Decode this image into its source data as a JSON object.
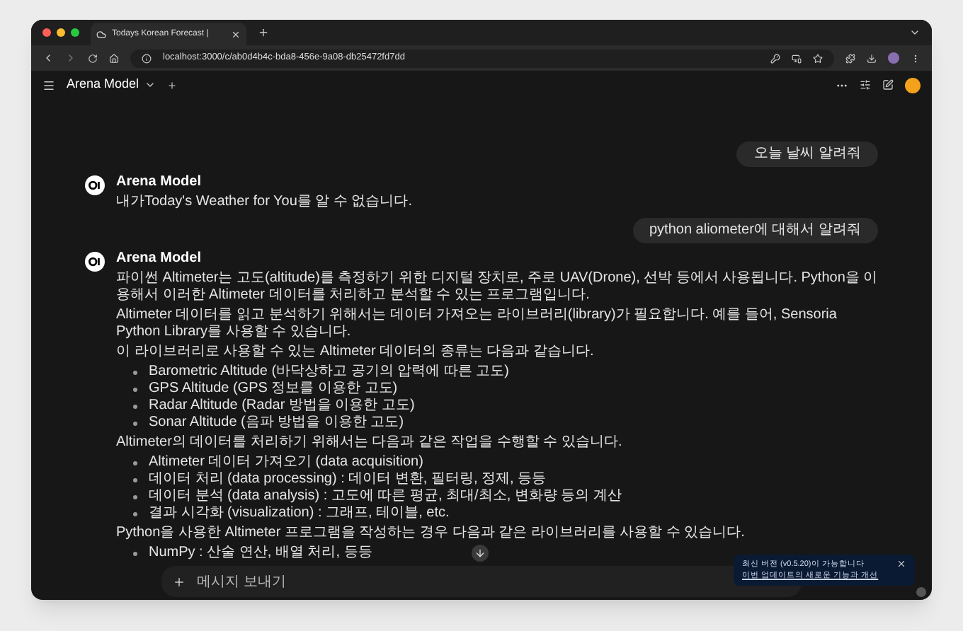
{
  "browser": {
    "tab_title": "Todays Korean Forecast |",
    "url": "localhost:3000/c/ab0d4b4c-bda8-456e-9a08-db25472fd7dd"
  },
  "header": {
    "model": "Arena Model"
  },
  "messages": [
    {
      "kind": "user",
      "text": "오늘 날씨 알려줘"
    },
    {
      "kind": "assistant",
      "name": "Arena Model",
      "blocks": [
        {
          "kind": "paragraph",
          "text": "내가Today's Weather for You를 알 수 없습니다."
        }
      ]
    },
    {
      "kind": "user",
      "text": "python aliometer에 대해서 알려줘"
    },
    {
      "kind": "assistant",
      "name": "Arena Model",
      "blocks": [
        {
          "kind": "paragraph",
          "text": "파이썬 Altimeter는 고도(altitude)를 측정하기 위한 디지털 장치로, 주로 UAV(Drone), 선박 등에서 사용됩니다. Python을 이용해서 이러한 Altimeter 데이터를 처리하고 분석할 수 있는 프로그램입니다."
        },
        {
          "kind": "paragraph",
          "text": "Altimeter 데이터를 읽고 분석하기 위해서는 데이터 가져오는 라이브러리(library)가 필요합니다. 예를 들어, Sensoria Python Library를 사용할 수 있습니다."
        },
        {
          "kind": "paragraph",
          "text": "이 라이브러리로 사용할 수 있는 Altimeter 데이터의 종류는 다음과 같습니다."
        },
        {
          "kind": "list",
          "items": [
            "Barometric Altitude (바닥상하고 공기의 압력에 따른 고도)",
            "GPS Altitude (GPS 정보를 이용한 고도)",
            "Radar Altitude (Radar 방법을 이용한 고도)",
            "Sonar Altitude (음파 방법을 이용한 고도)"
          ]
        },
        {
          "kind": "paragraph",
          "text": "Altimeter의 데이터를 처리하기 위해서는 다음과 같은 작업을 수행할 수 있습니다."
        },
        {
          "kind": "list",
          "items": [
            "Altimeter 데이터 가져오기 (data acquisition)",
            "데이터 처리 (data processing) : 데이터 변환, 필터링, 정제, 등등",
            "데이터 분석 (data analysis) : 고도에 따른 평균, 최대/최소, 변화량 등의 계산",
            "결과 시각화 (visualization) : 그래프, 테이블, etc."
          ]
        },
        {
          "kind": "paragraph",
          "text": "Python을 사용한 Altimeter 프로그램을 작성하는 경우 다음과 같은 라이브러리를 사용할 수 있습니다."
        },
        {
          "kind": "list",
          "items": [
            "NumPy : 산술 연산, 배열 처리, 등등"
          ]
        }
      ]
    }
  ],
  "input": {
    "placeholder": "메시지 보내기"
  },
  "toast": {
    "text": "최신 버전 (v0.5.20)이 가능합니다",
    "link": "이번 업데이트의 새로운 기능과 개선"
  }
}
